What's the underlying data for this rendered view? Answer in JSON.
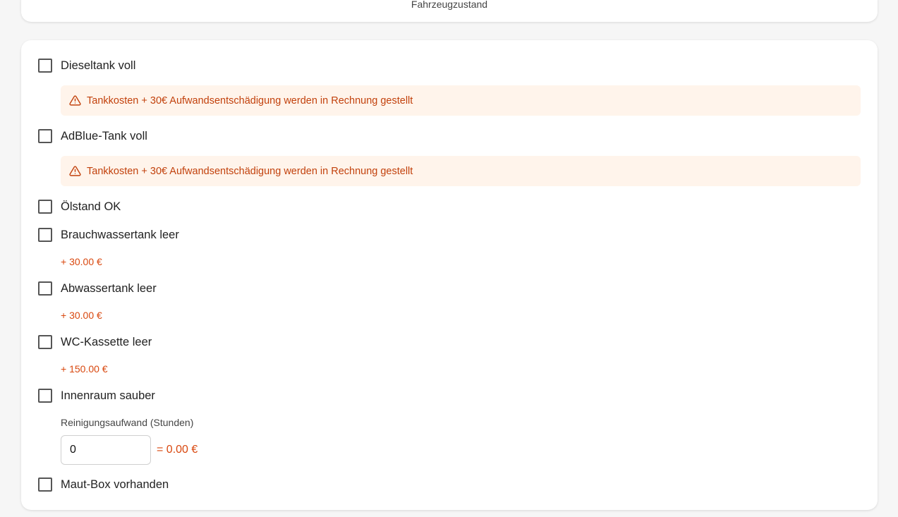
{
  "header": {
    "title": "Fahrzeugzustand"
  },
  "checklist": {
    "items": [
      {
        "label": "Dieseltank voll",
        "checked": false
      },
      {
        "label": "AdBlue-Tank voll",
        "checked": false
      },
      {
        "label": "Ölstand OK",
        "checked": false
      },
      {
        "label": "Brauchwassertank leer",
        "checked": false
      },
      {
        "label": "Abwassertank leer",
        "checked": false
      },
      {
        "label": "WC-Kassette leer",
        "checked": false
      },
      {
        "label": "Innenraum sauber",
        "checked": false
      },
      {
        "label": "Maut-Box vorhanden",
        "checked": false
      }
    ],
    "warnings": {
      "diesel": "Tankkosten + 30€ Aufwandsentschädigung werden in Rechnung gestellt",
      "adblue": "Tankkosten + 30€ Aufwandsentschädigung werden in Rechnung gestellt"
    },
    "fees": {
      "brauchwasser": "+ 30.00 €",
      "abwasser": "+ 30.00 €",
      "wc": "+ 150.00 €"
    },
    "cleaning": {
      "label": "Reinigungsaufwand (Stunden)",
      "value": "0",
      "result": "= 0.00 €"
    }
  },
  "colors": {
    "warning_bg": "#fff4eb",
    "warning_text": "#c2410c",
    "fee_text": "#d9480f"
  }
}
